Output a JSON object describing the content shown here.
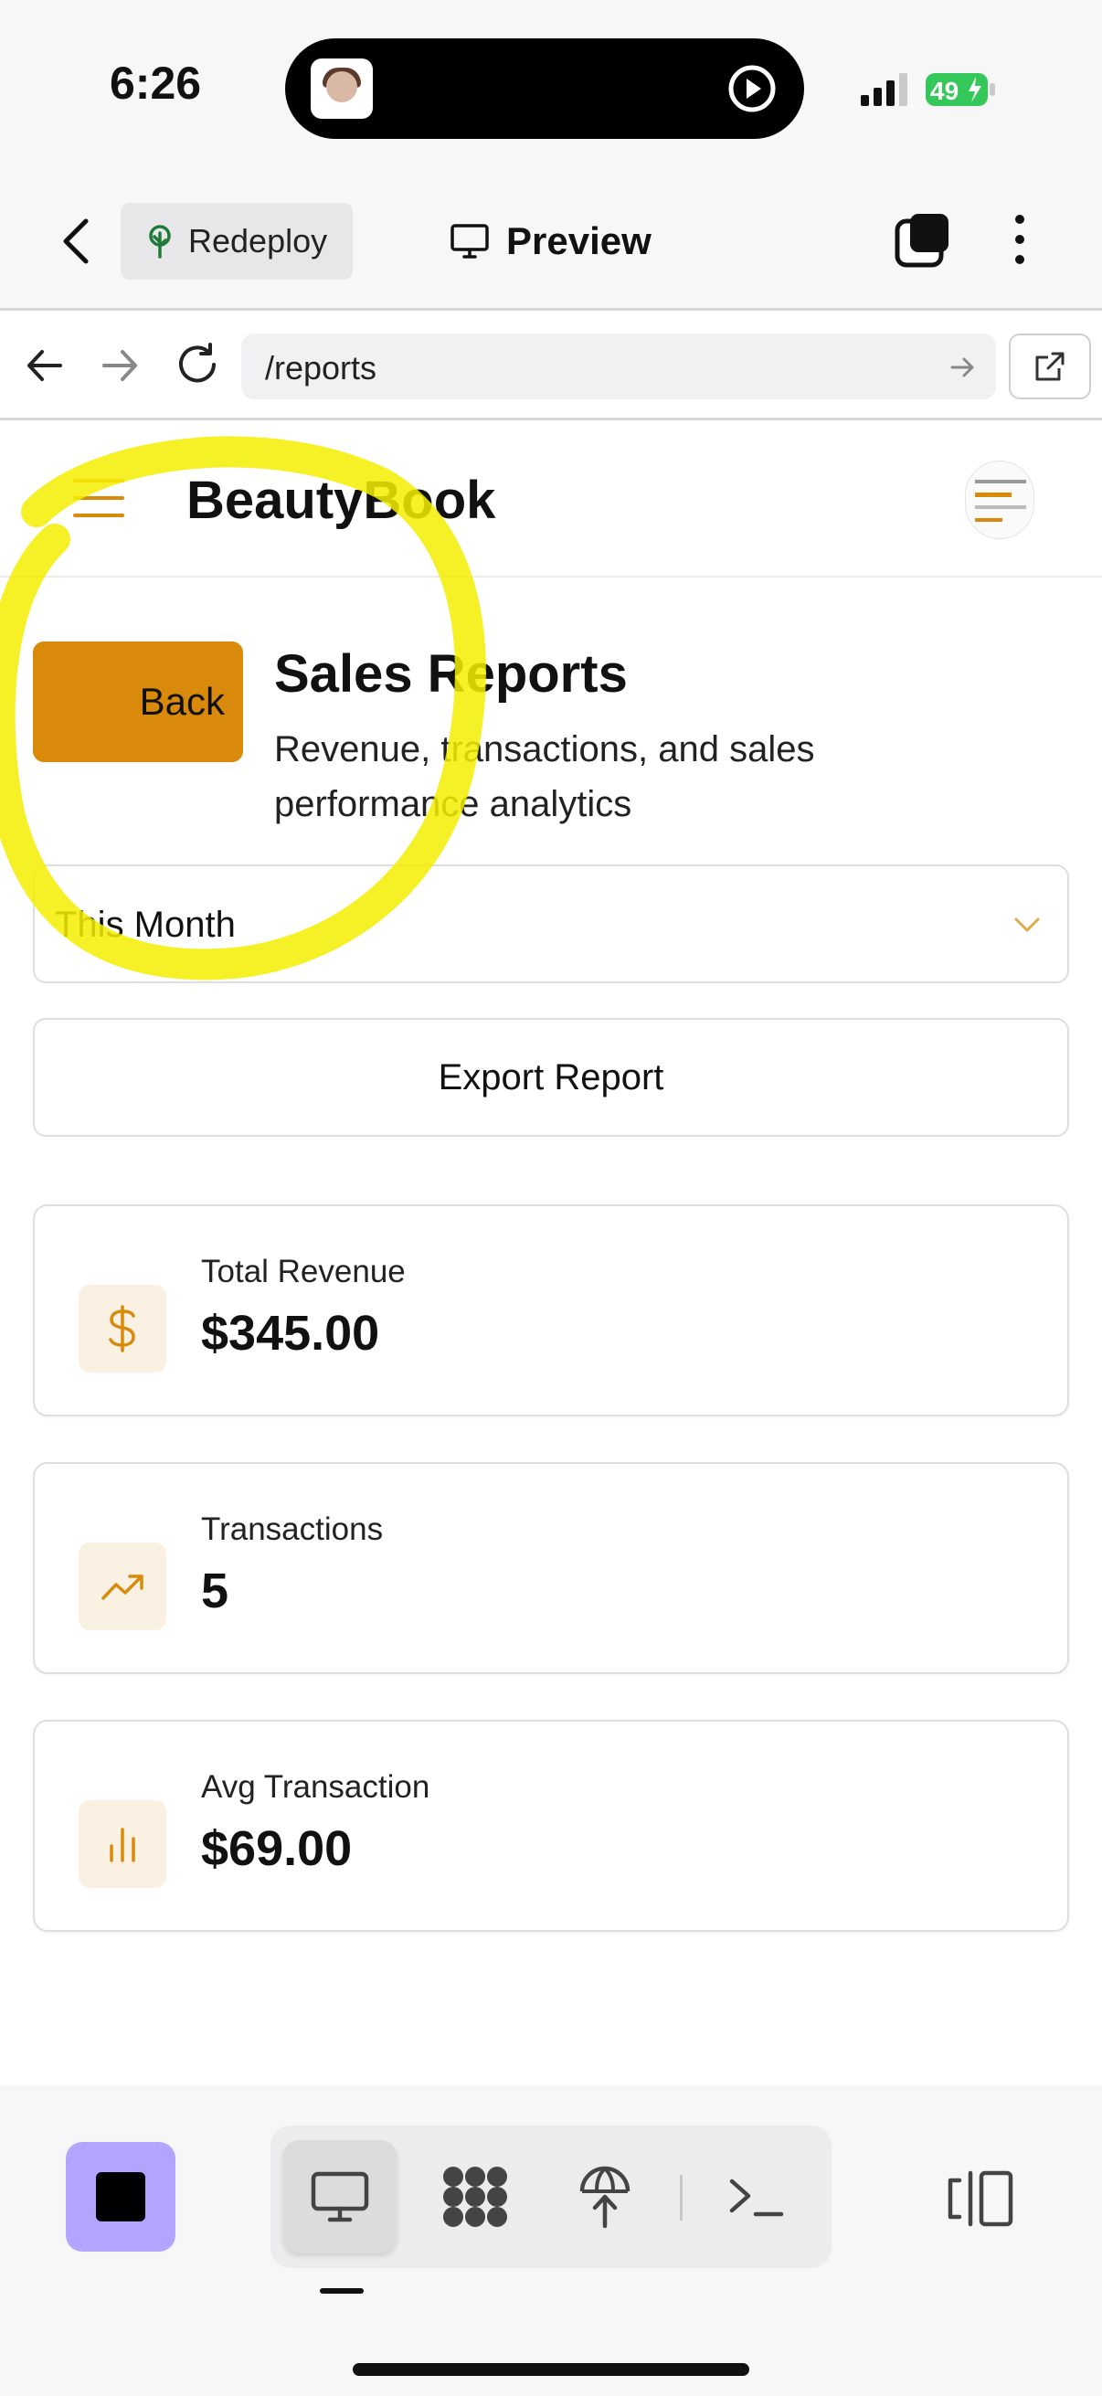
{
  "status_bar": {
    "time": "6:26",
    "battery": "49"
  },
  "app_header": {
    "redeploy_label": "Redeploy",
    "preview_label": "Preview"
  },
  "url_bar": {
    "url": "/reports"
  },
  "web": {
    "brand": "BeautyBook",
    "back_label": "Back",
    "title": "Sales Reports",
    "subtitle": "Revenue, transactions, and sales performance analytics",
    "period_select": {
      "value": "This Month"
    },
    "export_label": "Export Report",
    "cards": [
      {
        "label": "Total Revenue",
        "value": "$345.00",
        "icon": "dollar-icon"
      },
      {
        "label": "Transactions",
        "value": "5",
        "icon": "trending-up-icon"
      },
      {
        "label": "Avg Transaction",
        "value": "$69.00",
        "icon": "bar-chart-icon"
      }
    ]
  },
  "colors": {
    "accent": "#d98a0b",
    "accent_light": "#faf1e3",
    "annotation": "#f5ee00",
    "stop_button": "#b3a4ff"
  },
  "bottom_toolbar": {
    "tools": [
      "monitor-icon",
      "dots-grid-icon",
      "deploy-icon",
      "terminal-icon"
    ],
    "active_tool": "monitor-icon"
  }
}
